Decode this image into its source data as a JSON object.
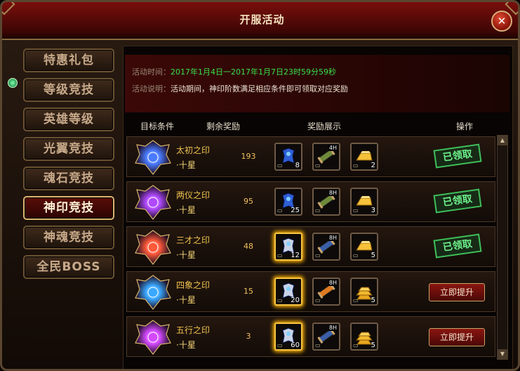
{
  "window": {
    "title": "开服活动",
    "close_symbol": "✕"
  },
  "sidebar": {
    "items": [
      {
        "label": "特惠礼包",
        "active": false
      },
      {
        "label": "等级竞技",
        "active": false
      },
      {
        "label": "英雄等级",
        "active": false
      },
      {
        "label": "光翼竞技",
        "active": false
      },
      {
        "label": "魂石竞技",
        "active": false
      },
      {
        "label": "神印竞技",
        "active": true
      },
      {
        "label": "神魂竞技",
        "active": false
      },
      {
        "label": "全民BOSS",
        "active": false
      }
    ]
  },
  "info": {
    "time_label": "活动时间：",
    "time_value": "2017年1月4日一2017年1月7日23时59分59秒",
    "desc_label": "活动说明：",
    "desc_value": "活动期间，神印阶数满足相应条件即可领取对应奖励"
  },
  "table": {
    "headers": {
      "target": "目标条件",
      "remaining": "剩余奖励",
      "rewards": "奖励展示",
      "action": "操作"
    },
    "rows": [
      {
        "name": "太初之印",
        "star": "·十星",
        "remaining": "193",
        "emblem_color": "#4a7bff",
        "rewards": [
          {
            "icon": "blue-armor-icon",
            "qty": "8",
            "glow": false
          },
          {
            "icon": "scroll-icon",
            "tag": "4H",
            "qty": "",
            "glow": false
          },
          {
            "icon": "gold-bar-icon",
            "qty": "2",
            "glow": false
          }
        ],
        "status": "claimed",
        "status_text": "已领取"
      },
      {
        "name": "两仪之印",
        "star": "·十星",
        "remaining": "95",
        "emblem_color": "#b14aff",
        "rewards": [
          {
            "icon": "blue-armor-icon",
            "qty": "25",
            "glow": false
          },
          {
            "icon": "scroll-icon",
            "tag": "8H",
            "qty": "",
            "glow": false
          },
          {
            "icon": "gold-bar-icon",
            "qty": "3",
            "glow": false
          }
        ],
        "status": "claimed",
        "status_text": "已领取"
      },
      {
        "name": "三才之印",
        "star": "·十星",
        "remaining": "48",
        "emblem_color": "#ff5a3a",
        "rewards": [
          {
            "icon": "silver-armor-icon",
            "qty": "12",
            "glow": true
          },
          {
            "icon": "blue-scroll-icon",
            "tag": "8H",
            "qty": "",
            "glow": false
          },
          {
            "icon": "gold-bar-icon",
            "qty": "5",
            "glow": false
          }
        ],
        "status": "claimed",
        "status_text": "已领取"
      },
      {
        "name": "四象之印",
        "star": "·十星",
        "remaining": "15",
        "emblem_color": "#3aa8ff",
        "rewards": [
          {
            "icon": "silver-armor-icon",
            "qty": "20",
            "glow": true
          },
          {
            "icon": "orange-scroll-icon",
            "tag": "8H",
            "qty": "",
            "glow": false
          },
          {
            "icon": "gold-bars-icon",
            "qty": "5",
            "glow": false
          }
        ],
        "status": "upgrade",
        "status_text": "立即提升"
      },
      {
        "name": "五行之印",
        "star": "·十星",
        "remaining": "3",
        "emblem_color": "#d44aff",
        "rewards": [
          {
            "icon": "silver-armor-icon",
            "qty": "60",
            "glow": true
          },
          {
            "icon": "blue-scroll-icon",
            "tag": "8H",
            "qty": "",
            "glow": false
          },
          {
            "icon": "gold-bars-icon",
            "qty": "5",
            "glow": false
          }
        ],
        "status": "upgrade",
        "status_text": "立即提升"
      }
    ]
  },
  "scrollbar": {
    "up": "▲",
    "down": "▼"
  }
}
